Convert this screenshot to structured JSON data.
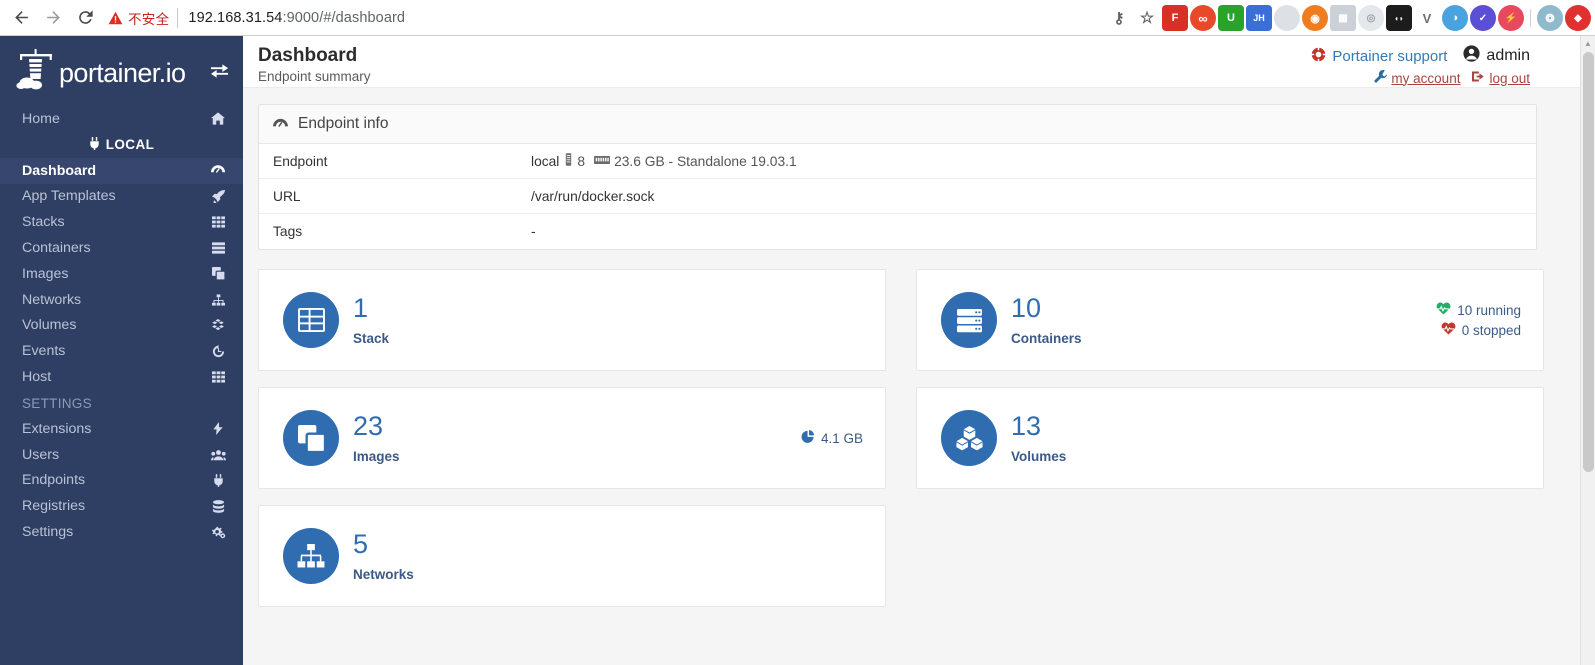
{
  "browser": {
    "back_icon": "back-arrow-icon",
    "forward_icon": "forward-arrow-icon",
    "reload_icon": "reload-icon",
    "security_label": "不安全",
    "url_host": "192.168.31.54",
    "url_port_path": ":9000/#/dashboard",
    "url_full": "192.168.31.54:9000/#/dashboard",
    "extensions": [
      {
        "name": "password-key-icon",
        "glyph": "⚷",
        "color": "#5f6368",
        "bg": "transparent"
      },
      {
        "name": "bookmark-star-icon",
        "glyph": "☆",
        "color": "#5f6368",
        "bg": "transparent"
      },
      {
        "name": "foxit-extension-icon",
        "glyph": "F",
        "color": "#ffffff",
        "bg": "#d93025"
      },
      {
        "name": "infinity-extension-icon",
        "glyph": "∞",
        "color": "#ffffff",
        "bg": "#e8492b"
      },
      {
        "name": "shield-extension-icon",
        "glyph": "U",
        "color": "#ffffff",
        "bg": "#2aa32a"
      },
      {
        "name": "jh-extension-icon",
        "glyph": "JH",
        "color": "#ffffff",
        "bg": "#3a6fd8"
      },
      {
        "name": "drop-extension-icon",
        "glyph": "◯",
        "color": "#ffffff",
        "bg": "#d7dbe0"
      },
      {
        "name": "orange-extension-icon",
        "glyph": "◉",
        "color": "#ffffff",
        "bg": "#f07c20"
      },
      {
        "name": "grid-extension-icon",
        "glyph": "▦",
        "color": "#ffffff",
        "bg": "#c9ced4"
      },
      {
        "name": "camera-extension-icon",
        "glyph": "◌",
        "color": "#ffffff",
        "bg": "#dfe3e8"
      },
      {
        "name": "panda-extension-icon",
        "glyph": "◖◗",
        "color": "#ffffff",
        "bg": "#1c1c1c"
      },
      {
        "name": "v-extension-icon",
        "glyph": "V",
        "color": "#5f6368",
        "bg": "transparent"
      },
      {
        "name": "compass-extension-icon",
        "glyph": "◑",
        "color": "#ffffff",
        "bg": "#4aa3df"
      },
      {
        "name": "check-extension-icon",
        "glyph": "✓",
        "color": "#ffffff",
        "bg": "#5b4fd6"
      },
      {
        "name": "bolt-extension-icon",
        "glyph": "⚡",
        "color": "#ffffff",
        "bg": "#e8495f"
      },
      {
        "name": "globe-extension-icon",
        "glyph": "❂",
        "color": "#ffffff",
        "bg": "#7fb3c8"
      },
      {
        "name": "red-circle-extension-icon",
        "glyph": "◆",
        "color": "#ffffff",
        "bg": "#e03131"
      }
    ]
  },
  "sidebar": {
    "brand": "portainer.io",
    "brand_logo_icon": "portainer-lighthouse-logo",
    "toggle_icon": "collapse-sidebar-icon",
    "home": {
      "label": "Home",
      "icon": "home-icon"
    },
    "local_section": {
      "label": "LOCAL",
      "icon": "plug-icon"
    },
    "local_items": [
      {
        "label": "Dashboard",
        "icon": "tachometer-icon",
        "active": true
      },
      {
        "label": "App Templates",
        "icon": "rocket-icon",
        "active": false
      },
      {
        "label": "Stacks",
        "icon": "th-grid-icon",
        "active": false
      },
      {
        "label": "Containers",
        "icon": "server-list-icon",
        "active": false
      },
      {
        "label": "Images",
        "icon": "clone-icon",
        "active": false
      },
      {
        "label": "Networks",
        "icon": "sitemap-icon",
        "active": false
      },
      {
        "label": "Volumes",
        "icon": "cubes-icon",
        "active": false
      },
      {
        "label": "Events",
        "icon": "history-icon",
        "active": false
      },
      {
        "label": "Host",
        "icon": "th-icon",
        "active": false
      }
    ],
    "settings_section": {
      "label": "SETTINGS"
    },
    "settings_items": [
      {
        "label": "Extensions",
        "icon": "bolt-icon"
      },
      {
        "label": "Users",
        "icon": "users-icon"
      },
      {
        "label": "Endpoints",
        "icon": "plug-icon"
      },
      {
        "label": "Registries",
        "icon": "database-icon"
      },
      {
        "label": "Settings",
        "icon": "cogs-icon"
      }
    ]
  },
  "header": {
    "title": "Dashboard",
    "subtitle": "Endpoint summary",
    "support_label": "Portainer support",
    "support_icon": "life-ring-icon",
    "user_label": "admin",
    "user_icon": "user-circle-icon",
    "my_account_label": "my account",
    "my_account_icon": "wrench-icon",
    "logout_label": "log out",
    "logout_icon": "sign-out-icon"
  },
  "endpoint_panel": {
    "title": "Endpoint info",
    "title_icon": "tachometer-icon",
    "rows": [
      {
        "key": "Endpoint",
        "value": "local",
        "cpu_icon": "cpu-icon",
        "cpu_value": "8",
        "memory_icon": "memory-icon",
        "memory_value": "23.6 GB - Standalone 19.03.1"
      },
      {
        "key": "URL",
        "value": "/var/run/docker.sock"
      },
      {
        "key": "Tags",
        "value": "-"
      }
    ]
  },
  "stat_cards": [
    {
      "count": "1",
      "label": "Stack",
      "icon": "th-grid-icon",
      "accent": "#2f6cb0",
      "extras": []
    },
    {
      "count": "10",
      "label": "Containers",
      "icon": "server-list-icon",
      "accent": "#2f6cb0",
      "extras": [
        {
          "icon": "heartbeat-green-icon",
          "text": "10 running",
          "color": "#23ae67"
        },
        {
          "icon": "heartbeat-red-icon",
          "text": "0 stopped",
          "color": "#c0392b"
        }
      ]
    },
    {
      "count": "23",
      "label": "Images",
      "icon": "clone-icon",
      "accent": "#2f6cb0",
      "extras": [
        {
          "icon": "pie-chart-icon",
          "text": "4.1 GB",
          "color": "#2f6cb0"
        }
      ]
    },
    {
      "count": "13",
      "label": "Volumes",
      "icon": "cubes-icon",
      "accent": "#2f6cb0",
      "extras": []
    },
    {
      "count": "5",
      "label": "Networks",
      "icon": "sitemap-icon",
      "accent": "#2f6cb0",
      "extras": []
    }
  ],
  "colors": {
    "sidebar_bg": "#2f3e63",
    "sidebar_active_bg": "#37466e",
    "accent_blue": "#2f6cb0",
    "page_bg": "#f5f5f5",
    "link_blue": "#337ab7",
    "danger_red": "#a94442",
    "running_green": "#23ae67",
    "stopped_red": "#c0392b"
  }
}
